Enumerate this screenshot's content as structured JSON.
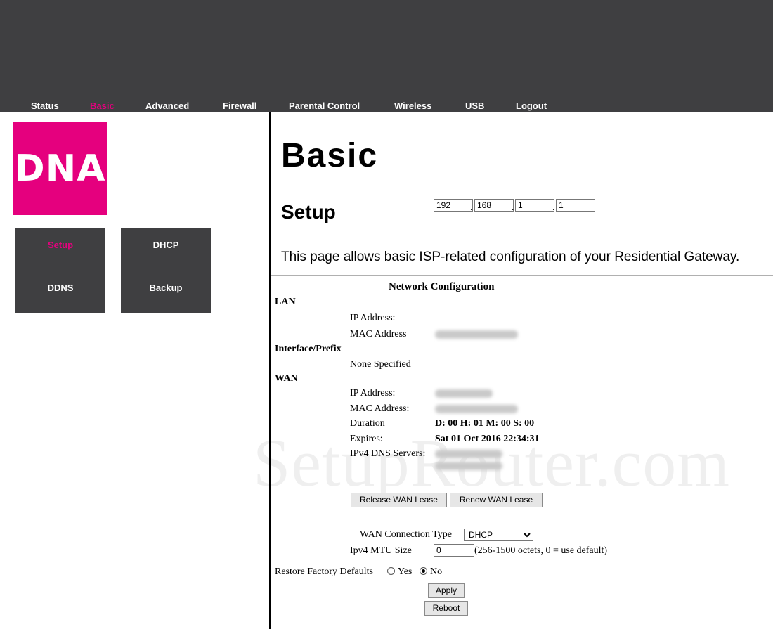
{
  "nav": {
    "items": [
      "Status",
      "Basic",
      "Advanced",
      "Firewall",
      "Parental Control",
      "Wireless",
      "USB",
      "Logout"
    ],
    "active": "Basic"
  },
  "logo": {
    "text": "DNA"
  },
  "subnav": {
    "items": [
      "Setup",
      "DHCP",
      "DDNS",
      "Backup"
    ],
    "active": "Setup"
  },
  "page": {
    "title": "Basic",
    "section": "Setup",
    "description": "This page allows basic ISP-related configuration of your Residential Gateway."
  },
  "network": {
    "heading": "Network Configuration",
    "lan": {
      "label": "LAN",
      "ip_label": "IP Address:",
      "ip_octets": [
        "192",
        "168",
        "1",
        "1"
      ],
      "mac_label": "MAC Address"
    },
    "interface": {
      "label": "Interface/Prefix",
      "value": "None Specified"
    },
    "wan": {
      "label": "WAN",
      "ip_label": "IP Address:",
      "mac_label": "MAC Address:",
      "duration_label": "Duration",
      "duration_value": "D: 00 H: 01 M: 00 S: 00",
      "expires_label": "Expires:",
      "expires_value": "Sat 01 Oct 2016 22:34:31",
      "dns_label": "IPv4 DNS Servers:"
    }
  },
  "buttons": {
    "release": "Release WAN Lease",
    "renew": "Renew WAN Lease",
    "apply": "Apply",
    "reboot": "Reboot"
  },
  "wan_type": {
    "label": "WAN Connection Type",
    "selected": "DHCP"
  },
  "mtu": {
    "label": "Ipv4 MTU Size",
    "value": "0",
    "hint": "(256-1500 octets, 0 = use default)"
  },
  "restore": {
    "label": "Restore Factory Defaults",
    "yes": "Yes",
    "no": "No",
    "selected": "No"
  },
  "watermark": "SetupRouter.com"
}
